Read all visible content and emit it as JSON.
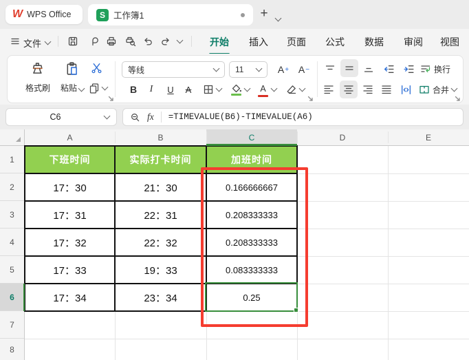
{
  "titlebar": {
    "app_name": "WPS Office",
    "logo_letter": "W",
    "doc_icon_letter": "S",
    "doc_tab_label": "工作簿1",
    "new_tab": "+"
  },
  "menubar": {
    "file_label": "文件",
    "tabs": [
      "开始",
      "插入",
      "页面",
      "公式",
      "数据",
      "审阅",
      "视图"
    ],
    "active_tab": "开始"
  },
  "toolbar": {
    "format_painter": "格式刷",
    "paste": "粘贴",
    "font_name": "等线",
    "font_size": "11",
    "font_letter": "A",
    "plus": "+",
    "minus": "−",
    "bold": "B",
    "italic": "I",
    "underline": "U",
    "strike": "A",
    "wrap": "换行",
    "merge": "合并"
  },
  "formula_bar": {
    "name_box": "C6",
    "fx": "fx",
    "formula": "=TIMEVALUE(B6)-TIMEVALUE(A6)"
  },
  "sheet": {
    "columns": [
      "A",
      "B",
      "C",
      "D",
      "E"
    ],
    "row_numbers": [
      "1",
      "2",
      "3",
      "4",
      "5",
      "6",
      "7",
      "8"
    ],
    "selected_cell": "C6",
    "selected_column": "C",
    "selected_row": "6",
    "table": {
      "headers": [
        "下班时间",
        "实际打卡时间",
        "加班时间"
      ],
      "rows": [
        [
          "17：30",
          "21：30",
          "0.166666667"
        ],
        [
          "17：31",
          "22：31",
          "0.208333333"
        ],
        [
          "17：32",
          "22：32",
          "0.208333333"
        ],
        [
          "17：33",
          "19：33",
          "0.083333333"
        ],
        [
          "17：34",
          "23：34",
          "0.25"
        ]
      ]
    }
  },
  "colors": {
    "header_green": "#92d050",
    "accent_teal": "#0d7d67",
    "selection_green": "#388e3c",
    "annotation_red": "#f53d30",
    "doc_icon_green": "#1fa05a",
    "logo_red": "#e03e2d"
  }
}
